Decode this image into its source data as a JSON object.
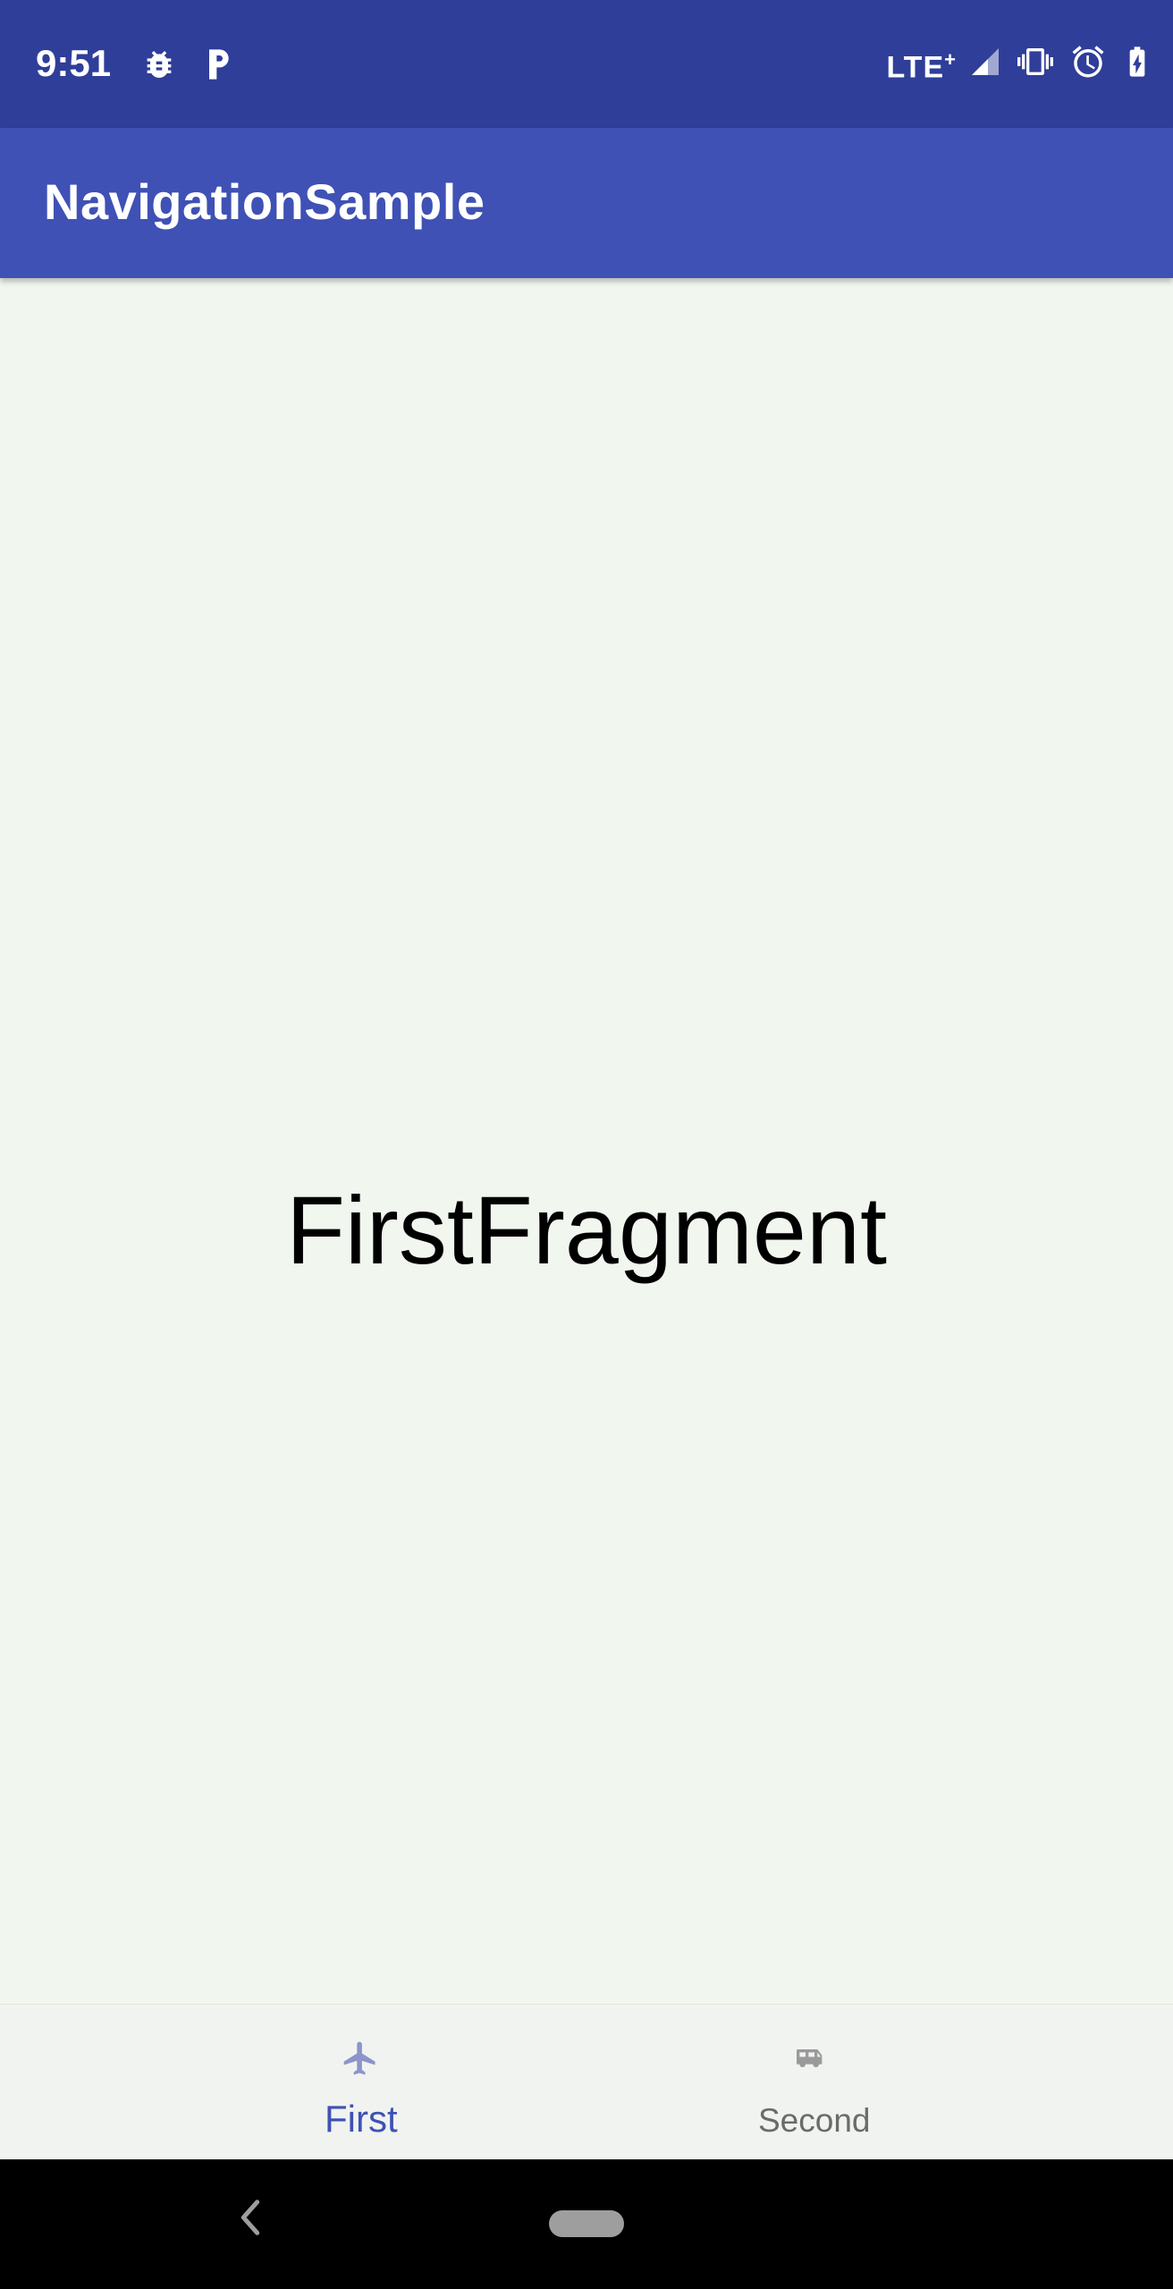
{
  "status_bar": {
    "time": "9:51",
    "network": "LTE",
    "network_plus": "+",
    "left_icons": [
      "bug-icon",
      "parking-icon"
    ],
    "right_icons": [
      "signal-icon",
      "vibrate-icon",
      "alarm-icon",
      "battery-charging-icon"
    ],
    "background": "#2f3e99"
  },
  "app_bar": {
    "title": "NavigationSample",
    "background": "#3f51b5"
  },
  "content": {
    "label": "FirstFragment",
    "background": "#f1f7ef"
  },
  "bottom_nav": {
    "items": [
      {
        "label": "First",
        "icon": "airplane-icon",
        "selected": true,
        "color": "#3f51b5"
      },
      {
        "label": "Second",
        "icon": "bus-icon",
        "selected": false,
        "color": "#6b6b6b"
      }
    ]
  },
  "system_nav": {
    "icons": [
      "back-chevron-icon",
      "home-pill-icon"
    ]
  }
}
